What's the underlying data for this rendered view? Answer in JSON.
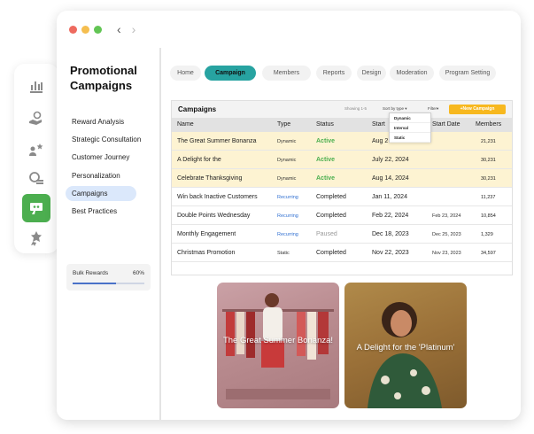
{
  "sidebar_icons": [
    "chart-icon",
    "hand-money-icon",
    "users-star-icon",
    "coin-stack-icon",
    "campaign-icon",
    "badge-icon"
  ],
  "window": {
    "controls": [
      "#ee6a5f",
      "#f5be4f",
      "#62c554"
    ]
  },
  "panel": {
    "title": "Promotional Campaigns",
    "items": [
      "Reward Analysis",
      "Strategic Consultation",
      "Customer Journey",
      "Personalization",
      "Campaigns",
      "Best Practices"
    ],
    "active_item": "Campaigns",
    "bulk": {
      "label": "Bulk Rewards",
      "percent": "60%",
      "progress": 0.6
    }
  },
  "tabs": [
    "Home",
    "Campaign",
    "Members",
    "Reports",
    "Design",
    "Moderation",
    "Program Setting"
  ],
  "active_tab": "Campaign",
  "table": {
    "title": "Campaigns",
    "showing": "Showing 1-5",
    "sort_label": "Sort by type",
    "filter_label": "Filter",
    "new_button": "+New Campaign",
    "sort_options": [
      "Dynamic",
      "Interval",
      "Static"
    ],
    "columns": [
      "Name",
      "Type",
      "Status",
      "Start",
      "Start Date",
      "Members"
    ],
    "rows": [
      {
        "name": "The Great Summer Bonanza",
        "type": "Dynamic",
        "status": "Active",
        "start": "Aug 2",
        "end": "",
        "members": "21,231"
      },
      {
        "name": "A Delight for the",
        "type": "Dynamic",
        "status": "Active",
        "start": "July 22, 2024",
        "end": "",
        "members": "30,231"
      },
      {
        "name": "Celebrate Thanksgiving",
        "type": "Dynamic",
        "status": "Active",
        "start": "Aug 14, 2024",
        "end": "",
        "members": "30,231"
      },
      {
        "name": "Win back Inactive Customers",
        "type": "Recurring",
        "status": "Completed",
        "start": "Jan 11, 2024",
        "end": "",
        "members": "11,237"
      },
      {
        "name": "Double Points Wednesday",
        "type": "Recurring",
        "status": "Completed",
        "start": "Feb 22, 2024",
        "end": "Feb 23, 2024",
        "members": "10,854"
      },
      {
        "name": "Monthly Engagement",
        "type": "Recurring",
        "status": "Paused",
        "start": "Dec 18, 2023",
        "end": "Dec 25, 2023",
        "members": "1,329"
      },
      {
        "name": "Christmas Promotion",
        "type": "Static",
        "status": "Completed",
        "start": "Nov 22, 2023",
        "end": "Nov 23, 2023",
        "members": "34,597"
      }
    ]
  },
  "cards": [
    {
      "title": "The Great Summer Bonanza!"
    },
    {
      "title": "A Delight for the 'Platinum'"
    }
  ]
}
